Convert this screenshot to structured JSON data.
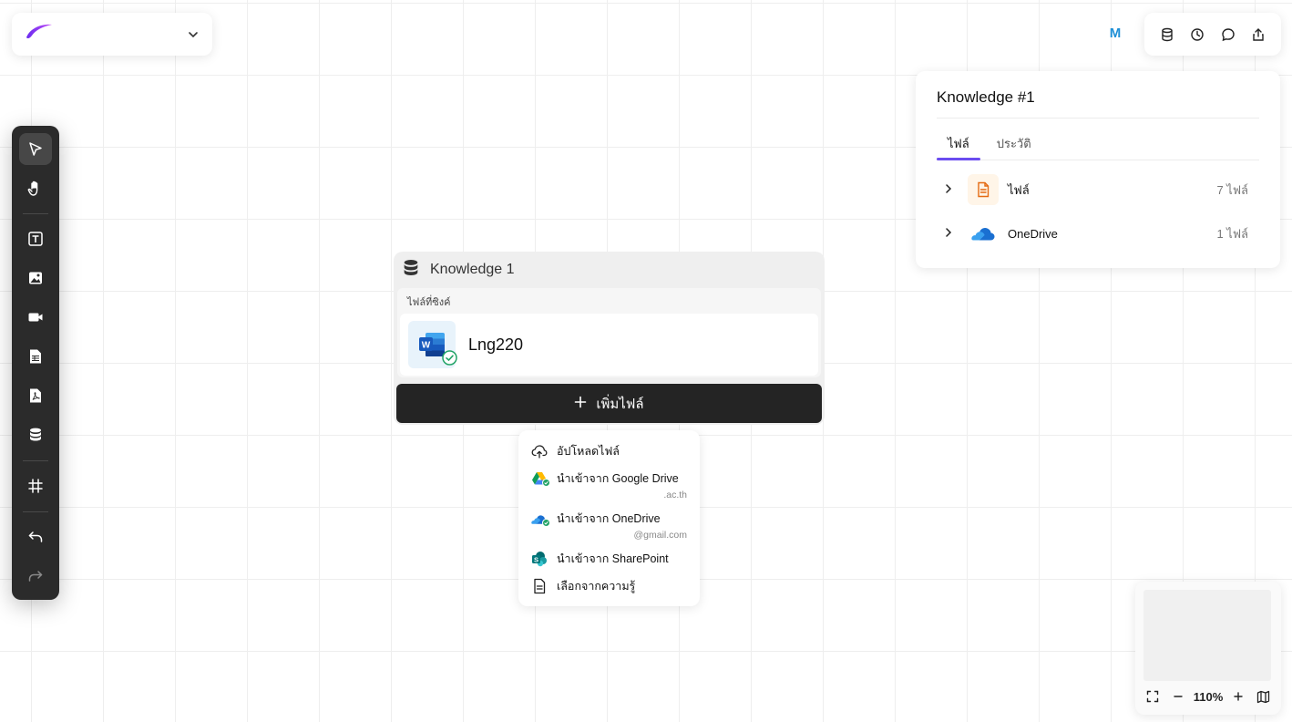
{
  "workspace": {
    "logo_icon": "brand-swoosh-icon",
    "dropdown_icon": "chevron-down-icon"
  },
  "user": {
    "avatar_initial": "M",
    "avatar_color": "#1e8fd6"
  },
  "topbar": {
    "icons": [
      "database-icon",
      "history-icon",
      "chat-icon",
      "share-icon"
    ]
  },
  "knowledge_panel": {
    "title": "Knowledge #1",
    "tabs": [
      {
        "label": "ไฟล์",
        "active": true
      },
      {
        "label": "ประวัติ",
        "active": false
      }
    ],
    "rows": [
      {
        "name": "ไฟล์",
        "count": "7 ไฟล์",
        "icon": "file-document-icon"
      },
      {
        "name": "OneDrive",
        "count": "1 ไฟล์",
        "icon": "onedrive-icon"
      }
    ]
  },
  "toolbar": {
    "tools": [
      "select-pointer-icon",
      "hand-pan-icon",
      "text-tool-icon",
      "image-tool-icon",
      "video-tool-icon",
      "table-tool-icon",
      "pdf-tool-icon",
      "knowledge-db-icon",
      "frame-grid-icon",
      "undo-icon",
      "redo-icon"
    ]
  },
  "node": {
    "title": "Knowledge 1",
    "synced_label": "ไฟล์ที่ซิงค์",
    "file": {
      "name": "Lng220",
      "icon": "word-doc-icon"
    },
    "add_button": "เพิ่มไฟล์",
    "add_icon": "plus-icon"
  },
  "menu": {
    "items": [
      {
        "label": "อัปโหลดไฟล์",
        "sub": "",
        "icon": "cloud-upload-icon"
      },
      {
        "label": "นำเข้าจาก Google Drive",
        "sub": ".ac.th",
        "icon": "google-drive-icon"
      },
      {
        "label": "นำเข้าจาก OneDrive",
        "sub": "@gmail.com",
        "icon": "onedrive-icon"
      },
      {
        "label": "นำเข้าจาก SharePoint",
        "sub": "",
        "icon": "sharepoint-icon"
      },
      {
        "label": "เลือกจากความรู้",
        "sub": "",
        "icon": "document-icon"
      }
    ]
  },
  "minimap": {
    "zoom": "110%",
    "accent": "#6b4cf0"
  }
}
